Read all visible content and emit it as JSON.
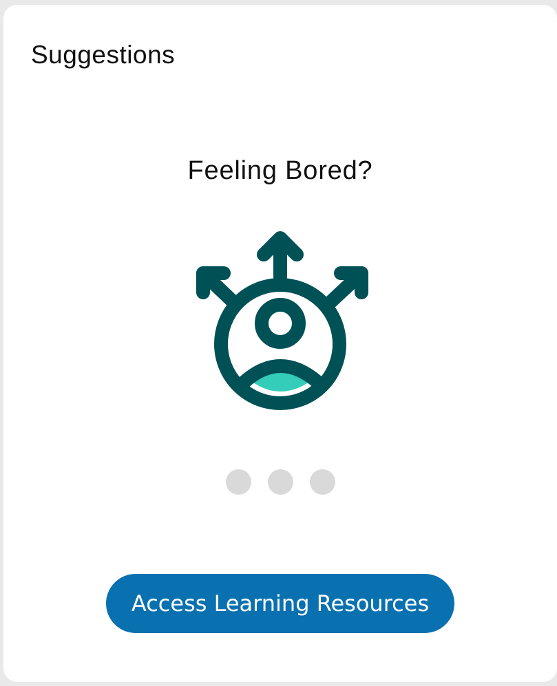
{
  "card": {
    "title": "Suggestions"
  },
  "suggestion": {
    "heading": "Feeling Bored?",
    "illustration_icon": "person-with-branching-arrows-icon",
    "colors": {
      "outline": "#005155",
      "fill": "#33cdb9"
    }
  },
  "pager": {
    "dot_count": 3,
    "dot_color": "#d9d9d9"
  },
  "cta": {
    "label": "Access Learning Resources",
    "background": "#0a71b1",
    "text_color": "#ffffff"
  }
}
